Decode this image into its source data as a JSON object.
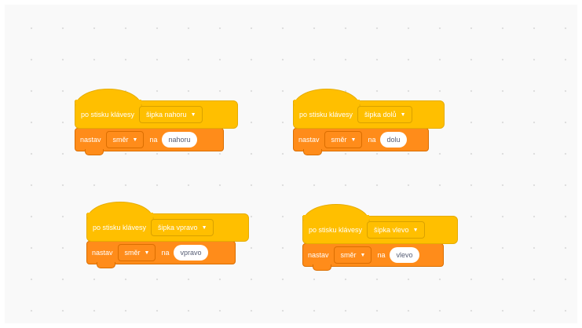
{
  "scripts": [
    {
      "hat_text": "po stisku klávesy",
      "key_option": "šipka nahoru",
      "action_text": "nastav",
      "property_option": "směr",
      "connector": "na",
      "value": "nahoru"
    },
    {
      "hat_text": "po stisku klávesy",
      "key_option": "šipka dolů",
      "action_text": "nastav",
      "property_option": "směr",
      "connector": "na",
      "value": "dolu"
    },
    {
      "hat_text": "po stisku klávesy",
      "key_option": "šipka vpravo",
      "action_text": "nastav",
      "property_option": "směr",
      "connector": "na",
      "value": "vpravo"
    },
    {
      "hat_text": "po stisku klávesy",
      "key_option": "šipka vlevo",
      "action_text": "nastav",
      "property_option": "směr",
      "connector": "na",
      "value": "vlevo"
    }
  ],
  "icons": {
    "dropdown": "dropdown-caret-icon"
  },
  "colors": {
    "event_block": "#ffbf00",
    "variable_block": "#ff8c1a",
    "canvas": "#f9f9f9"
  }
}
